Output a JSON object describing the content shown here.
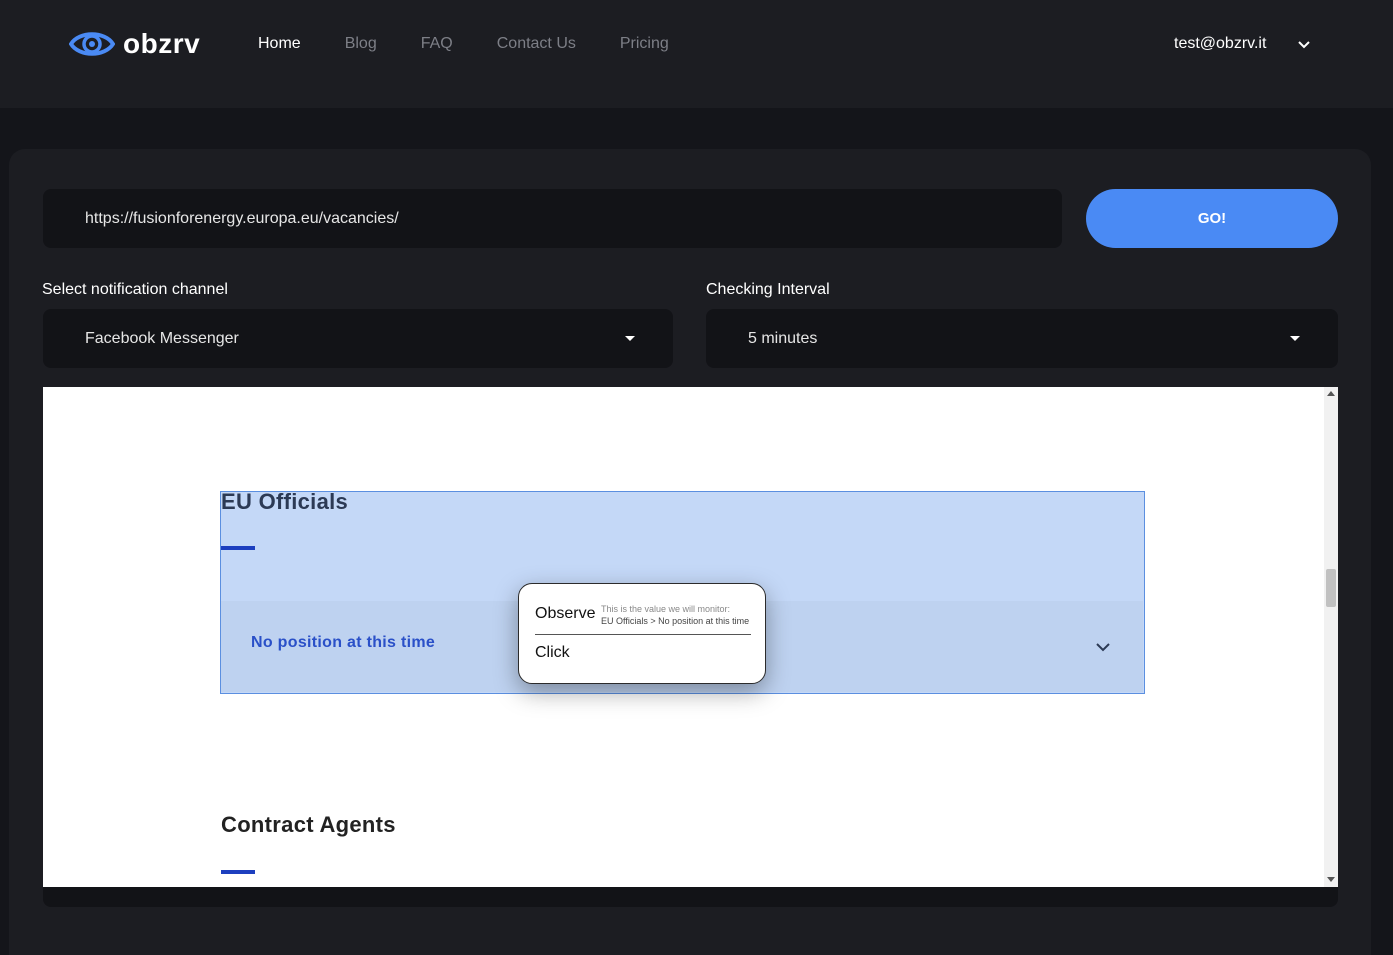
{
  "header": {
    "logo_text": "obzrv",
    "nav": [
      "Home",
      "Blog",
      "FAQ",
      "Contact Us",
      "Pricing"
    ],
    "active_nav": "Home",
    "user_email": "test@obzrv.it"
  },
  "form": {
    "url_value": "https://fusionforenergy.europa.eu/vacancies/",
    "go_label": "GO!",
    "channel_label": "Select notification channel",
    "channel_value": "Facebook Messenger",
    "interval_label": "Checking Interval",
    "interval_value": "5 minutes"
  },
  "preview": {
    "section1_title": "EU Officials",
    "section1_item": "No position at this time",
    "section2_title": "Contract Agents"
  },
  "popup": {
    "observe_label": "Observe",
    "hint": "This is the value we will monitor:",
    "value": "EU Officials > No position at this time",
    "click_label": "Click"
  },
  "colors": {
    "accent": "#4a8af4",
    "highlight": "#c4d8f7",
    "background": "#14151a"
  },
  "icons": [
    "eye-logo-icon",
    "chevron-down-icon",
    "caret-down-icon"
  ]
}
